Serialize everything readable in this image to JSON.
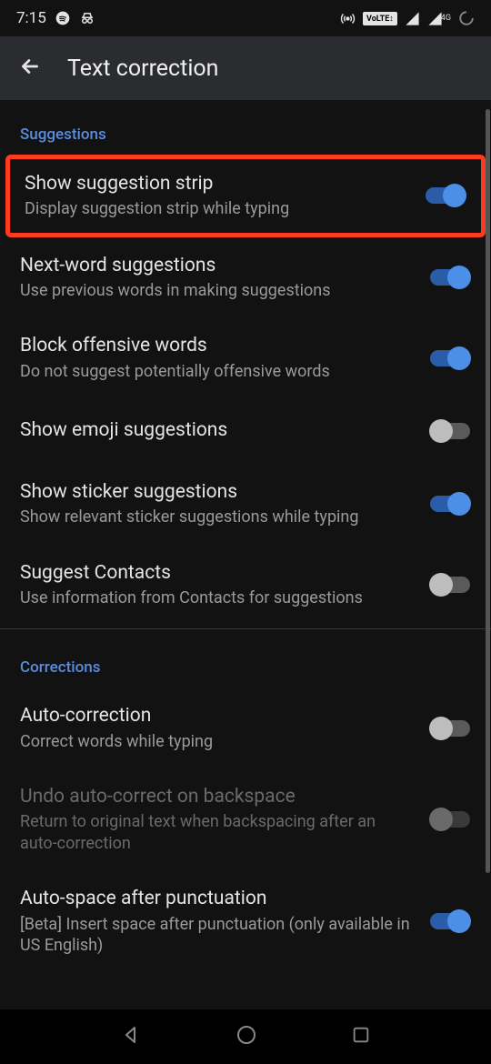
{
  "status_bar": {
    "time": "7:15"
  },
  "app_bar": {
    "title": "Text correction"
  },
  "sections": {
    "suggestions": {
      "header": "Suggestions",
      "items": [
        {
          "title": "Show suggestion strip",
          "subtitle": "Display suggestion strip while typing",
          "on": true,
          "highlighted": true
        },
        {
          "title": "Next-word suggestions",
          "subtitle": "Use previous words in making suggestions",
          "on": true
        },
        {
          "title": "Block offensive words",
          "subtitle": "Do not suggest potentially offensive words",
          "on": true
        },
        {
          "title": "Show emoji suggestions",
          "subtitle": "",
          "on": false
        },
        {
          "title": "Show sticker suggestions",
          "subtitle": "Show relevant sticker suggestions while typing",
          "on": true
        },
        {
          "title": "Suggest Contacts",
          "subtitle": "Use information from Contacts for suggestions",
          "on": false
        }
      ]
    },
    "corrections": {
      "header": "Corrections",
      "items": [
        {
          "title": "Auto-correction",
          "subtitle": "Correct words while typing",
          "on": false
        },
        {
          "title": "Undo auto-correct on backspace",
          "subtitle": "Return to original text when backspacing after an auto-correction",
          "on": false,
          "disabled": true
        },
        {
          "title": "Auto-space after punctuation",
          "subtitle": "[Beta] Insert space after punctuation (only available in US English)",
          "on": true
        }
      ]
    }
  }
}
